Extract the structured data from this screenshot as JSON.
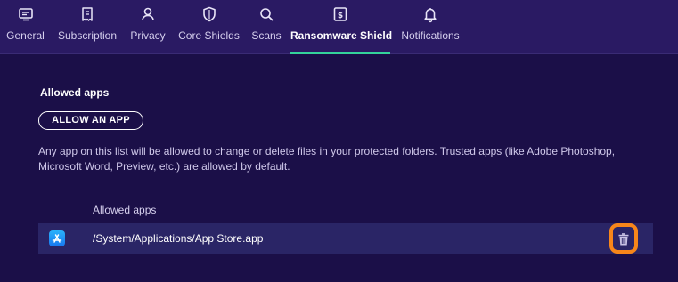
{
  "tabs": [
    {
      "label": "General",
      "icon": "monitor-icon"
    },
    {
      "label": "Subscription",
      "icon": "receipt-icon"
    },
    {
      "label": "Privacy",
      "icon": "person-icon"
    },
    {
      "label": "Core Shields",
      "icon": "shield-icon"
    },
    {
      "label": "Scans",
      "icon": "scan-search-icon"
    },
    {
      "label": "Ransomware Shield",
      "icon": "ransomware-shield-icon",
      "active": true
    },
    {
      "label": "Notifications",
      "icon": "bell-icon"
    }
  ],
  "main": {
    "section_title": "Allowed apps",
    "allow_button_label": "ALLOW AN APP",
    "description": "Any app on this list will be allowed to change or delete files in your protected folders. Trusted apps (like Adobe Photoshop, Microsoft Word, Preview, etc.) are allowed by default.",
    "list_header": "Allowed apps",
    "apps": [
      {
        "path": "/System/Applications/App Store.app",
        "icon": "app-store-icon"
      }
    ]
  },
  "colors": {
    "background": "#1b0f48",
    "tab_bar": "#2a1a63",
    "active_underline": "#34d39b",
    "row_background": "#2a2566",
    "highlight": "#f7861a"
  }
}
